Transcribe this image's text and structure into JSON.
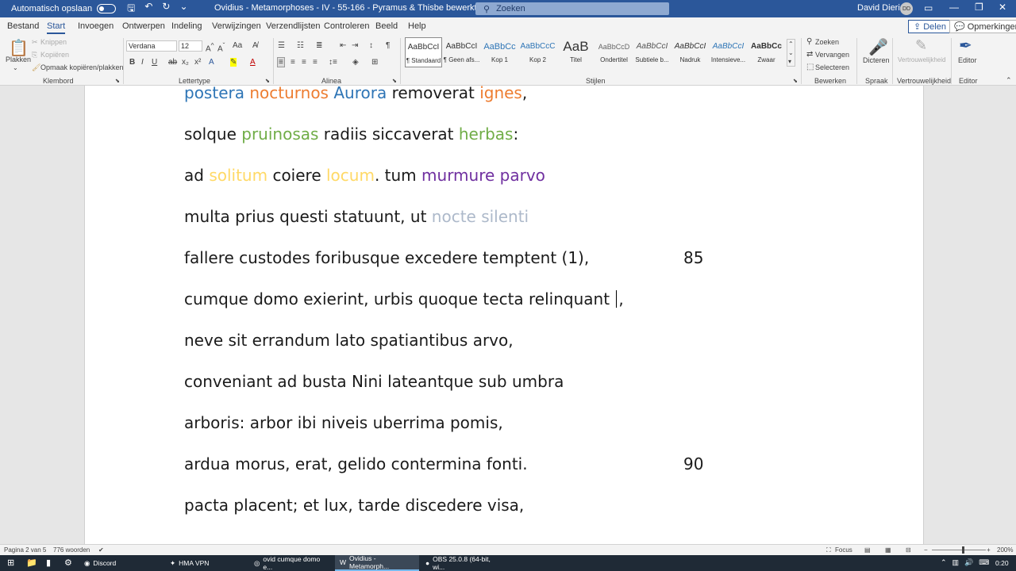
{
  "titlebar": {
    "autosave_label": "Automatisch opslaan",
    "doc_title": "Ovidius - Metamorphoses - IV - 55-166 - Pyramus & Thisbe bewerkt.docx",
    "search_placeholder": "Zoeken",
    "user_name": "David Dierick",
    "user_initials": "DD"
  },
  "tabs": [
    "Bestand",
    "Start",
    "Invoegen",
    "Ontwerpen",
    "Indeling",
    "Verwijzingen",
    "Verzendlijsten",
    "Controleren",
    "Beeld",
    "Help"
  ],
  "active_tab": "Start",
  "share_label": "Delen",
  "comments_label": "Opmerkingen",
  "ribbon": {
    "clipboard": {
      "paste": "Plakken",
      "cut": "Knippen",
      "copy": "Kopiëren",
      "format_painter": "Opmaak kopiëren/plakken",
      "label": "Klembord"
    },
    "font": {
      "name": "Verdana",
      "size": "12",
      "label": "Lettertype"
    },
    "paragraph": {
      "label": "Alinea"
    },
    "styles": {
      "label": "Stijlen",
      "items": [
        {
          "sample": "AaBbCcI",
          "name": "¶ Standaard"
        },
        {
          "sample": "AaBbCcI",
          "name": "¶ Geen afs..."
        },
        {
          "sample": "AaBbCc",
          "name": "Kop 1"
        },
        {
          "sample": "AaBbCcC",
          "name": "Kop 2"
        },
        {
          "sample": "AaB",
          "name": "Titel"
        },
        {
          "sample": "AaBbCcD",
          "name": "Ondertitel"
        },
        {
          "sample": "AaBbCcI",
          "name": "Subtiele b..."
        },
        {
          "sample": "AaBbCcI",
          "name": "Nadruk"
        },
        {
          "sample": "AaBbCcI",
          "name": "Intensieve..."
        },
        {
          "sample": "AaBbCc",
          "name": "Zwaar"
        }
      ]
    },
    "editing": {
      "find": "Zoeken",
      "replace": "Vervangen",
      "select": "Selecteren",
      "label": "Bewerken"
    },
    "dictate": {
      "label": "Dicteren",
      "group": "Spraak"
    },
    "sensitivity": {
      "label": "Vertrouwelijkheid",
      "group": "Vertrouwelijkheid"
    },
    "editor": {
      "label": "Editor",
      "group": "Editor"
    }
  },
  "document": {
    "lines": [
      {
        "segments": [
          {
            "t": "postera ",
            "c": "blue"
          },
          {
            "t": "nocturnos ",
            "c": "orange"
          },
          {
            "t": "Aurora ",
            "c": "blue"
          },
          {
            "t": "removerat ",
            "c": ""
          },
          {
            "t": "ignes",
            "c": "orange"
          },
          {
            "t": ",",
            "c": ""
          }
        ],
        "num": ""
      },
      {
        "segments": [
          {
            "t": "solque ",
            "c": ""
          },
          {
            "t": "pruinosas ",
            "c": "green"
          },
          {
            "t": "radiis siccaverat ",
            "c": ""
          },
          {
            "t": "herbas",
            "c": "green"
          },
          {
            "t": ":",
            "c": ""
          }
        ],
        "num": ""
      },
      {
        "segments": [
          {
            "t": "ad ",
            "c": ""
          },
          {
            "t": "solitum ",
            "c": "yellow"
          },
          {
            "t": "coiere ",
            "c": ""
          },
          {
            "t": "locum",
            "c": "yellow"
          },
          {
            "t": ". tum ",
            "c": ""
          },
          {
            "t": "murmure parvo",
            "c": "purple"
          }
        ],
        "num": ""
      },
      {
        "segments": [
          {
            "t": "multa prius questi statuunt, ut ",
            "c": ""
          },
          {
            "t": "nocte silenti",
            "c": "gray"
          }
        ],
        "num": ""
      },
      {
        "segments": [
          {
            "t": "fallere custodes foribusque excedere temptent (1),",
            "c": ""
          }
        ],
        "num": "85"
      },
      {
        "segments": [
          {
            "t": "cumque domo exierint, urbis quoque tecta relinquant ",
            "c": ""
          },
          {
            "t": ",",
            "c": ""
          }
        ],
        "num": "",
        "cursor": true
      },
      {
        "segments": [
          {
            "t": "neve sit errandum lato spatiantibus arvo,",
            "c": ""
          }
        ],
        "num": ""
      },
      {
        "segments": [
          {
            "t": "conveniant ad busta Nini lateantque sub umbra",
            "c": ""
          }
        ],
        "num": ""
      },
      {
        "segments": [
          {
            "t": "arboris: arbor ibi niveis uberrima pomis,",
            "c": ""
          }
        ],
        "num": ""
      },
      {
        "segments": [
          {
            "t": "ardua morus, erat, gelido contermina fonti.",
            "c": ""
          }
        ],
        "num": "90"
      },
      {
        "segments": [
          {
            "t": "pacta placent; et lux, tarde discedere visa,",
            "c": ""
          }
        ],
        "num": ""
      }
    ]
  },
  "statusbar": {
    "page": "Pagina 2 van 5",
    "words": "776 woorden",
    "focus": "Focus",
    "zoom": "200%"
  },
  "taskbar": {
    "items": [
      {
        "label": "Discord",
        "active": false
      },
      {
        "label": "HMA VPN",
        "active": false
      },
      {
        "label": "ovid cumque domo e...",
        "active": false
      },
      {
        "label": "Ovidius - Metamorph...",
        "active": true
      },
      {
        "label": "OBS 25.0.8 (64-bit, wi...",
        "active": false
      }
    ],
    "clock": "0:20"
  },
  "colors": {
    "blue": "#2e75b6",
    "orange": "#ed7d31",
    "green": "#70ad47",
    "yellow": "#ffd966",
    "purple": "#7030a0",
    "gray": "#adb9ca",
    "word_blue": "#2b579a"
  }
}
